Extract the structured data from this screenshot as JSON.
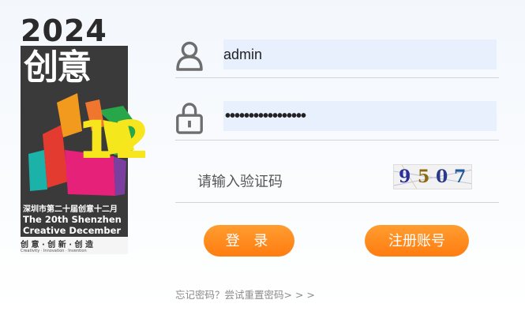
{
  "poster": {
    "year": "2024",
    "title": "创意",
    "numeral": "12",
    "line_cn": "深圳市第二十届创意十二月",
    "line_en1": "The 20th Shenzhen",
    "line_en2": "Creative December",
    "slogan_cn": "创 意 · 创 新 · 创 造",
    "slogan_en": "Creativity · Innovation · Invention"
  },
  "form": {
    "username_value": "admin",
    "password_mask": "•••••••••••••••••",
    "captcha_placeholder": "请输入验证码",
    "captcha_text": [
      "9",
      "5",
      "0",
      "7"
    ],
    "captcha_colors": [
      "#2a2f9a",
      "#8c6a10",
      "#2a3a8a",
      "#1f5a9a"
    ]
  },
  "buttons": {
    "login": "登 录",
    "register": "注册账号"
  },
  "links": {
    "forgot": "忘记密码？尝试重置密码> > >"
  },
  "colors": {
    "accent": "#ff8a1f",
    "field_bg": "#e8f0fe",
    "icon": "#6e6e6e"
  }
}
